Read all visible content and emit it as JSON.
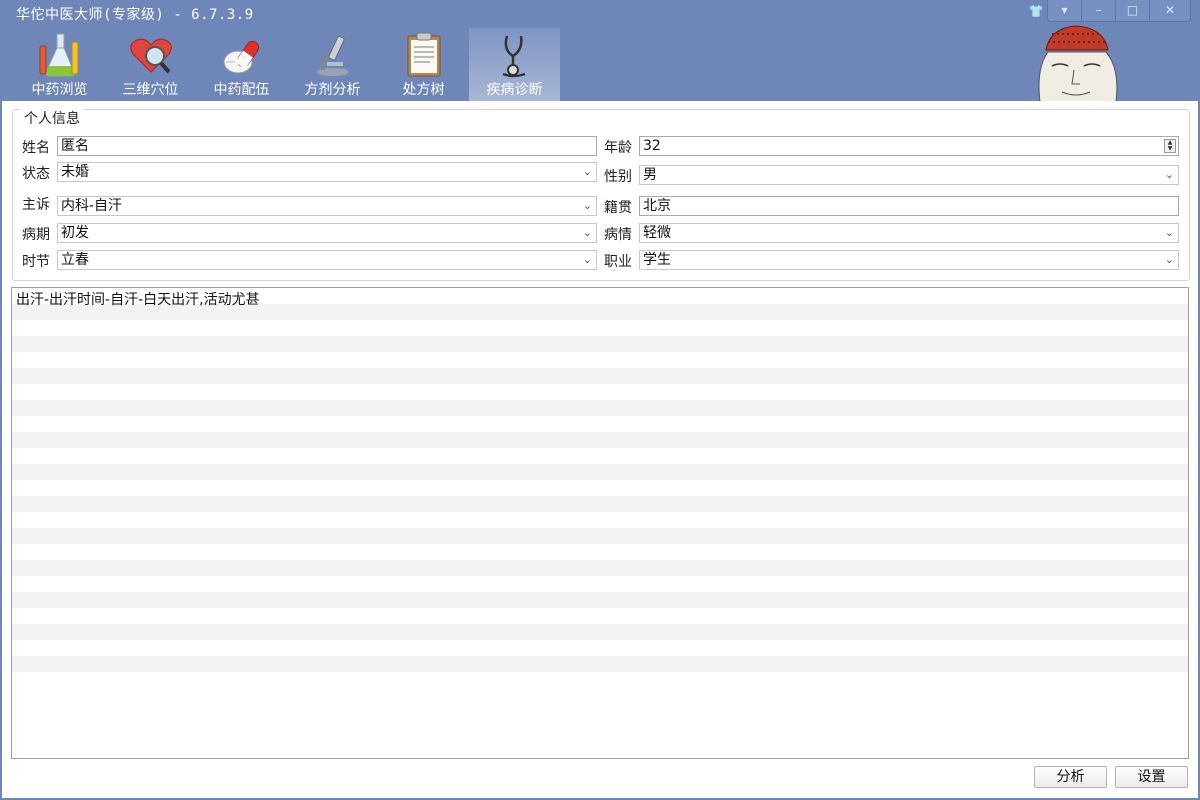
{
  "window": {
    "title": "华佗中医大师(专家级) - 6.7.3.9",
    "buttons": [
      "▾",
      "–",
      "□",
      "✕"
    ],
    "skin_icon": "shirt-icon"
  },
  "toolbar": {
    "tabs": [
      {
        "label": "中药浏览",
        "icon": "flask-icon"
      },
      {
        "label": "三维穴位",
        "icon": "heart-magnifier-icon"
      },
      {
        "label": "中药配伍",
        "icon": "pills-icon"
      },
      {
        "label": "方剂分析",
        "icon": "microscope-icon"
      },
      {
        "label": "处方树",
        "icon": "clipboard-icon"
      },
      {
        "label": "疾病诊断",
        "icon": "stethoscope-icon",
        "active": true
      }
    ]
  },
  "personal_info": {
    "legend": "个人信息",
    "name_label": "姓名",
    "name_value": "匿名",
    "age_label": "年龄",
    "age_value": "32",
    "status_label": "状态",
    "status_value": "未婚",
    "gender_label": "性别",
    "gender_value": "男",
    "complaint_label": "主诉",
    "complaint_value": "内科-自汗",
    "origin_label": "籍贯",
    "origin_value": "北京",
    "stage_label": "病期",
    "stage_value": "初发",
    "severity_label": "病情",
    "severity_value": "轻微",
    "season_label": "时节",
    "season_value": "立春",
    "job_label": "职业",
    "job_value": "学生"
  },
  "symptoms": {
    "text": "出汗-出汗时间-自汗-白天出汗,活动尤甚"
  },
  "actions": {
    "analyze_label": "分析",
    "settings_label": "设置"
  },
  "colors": {
    "chrome": "#6f87b8",
    "panel": "#ffffff",
    "stripe": "#f3f3f3"
  }
}
